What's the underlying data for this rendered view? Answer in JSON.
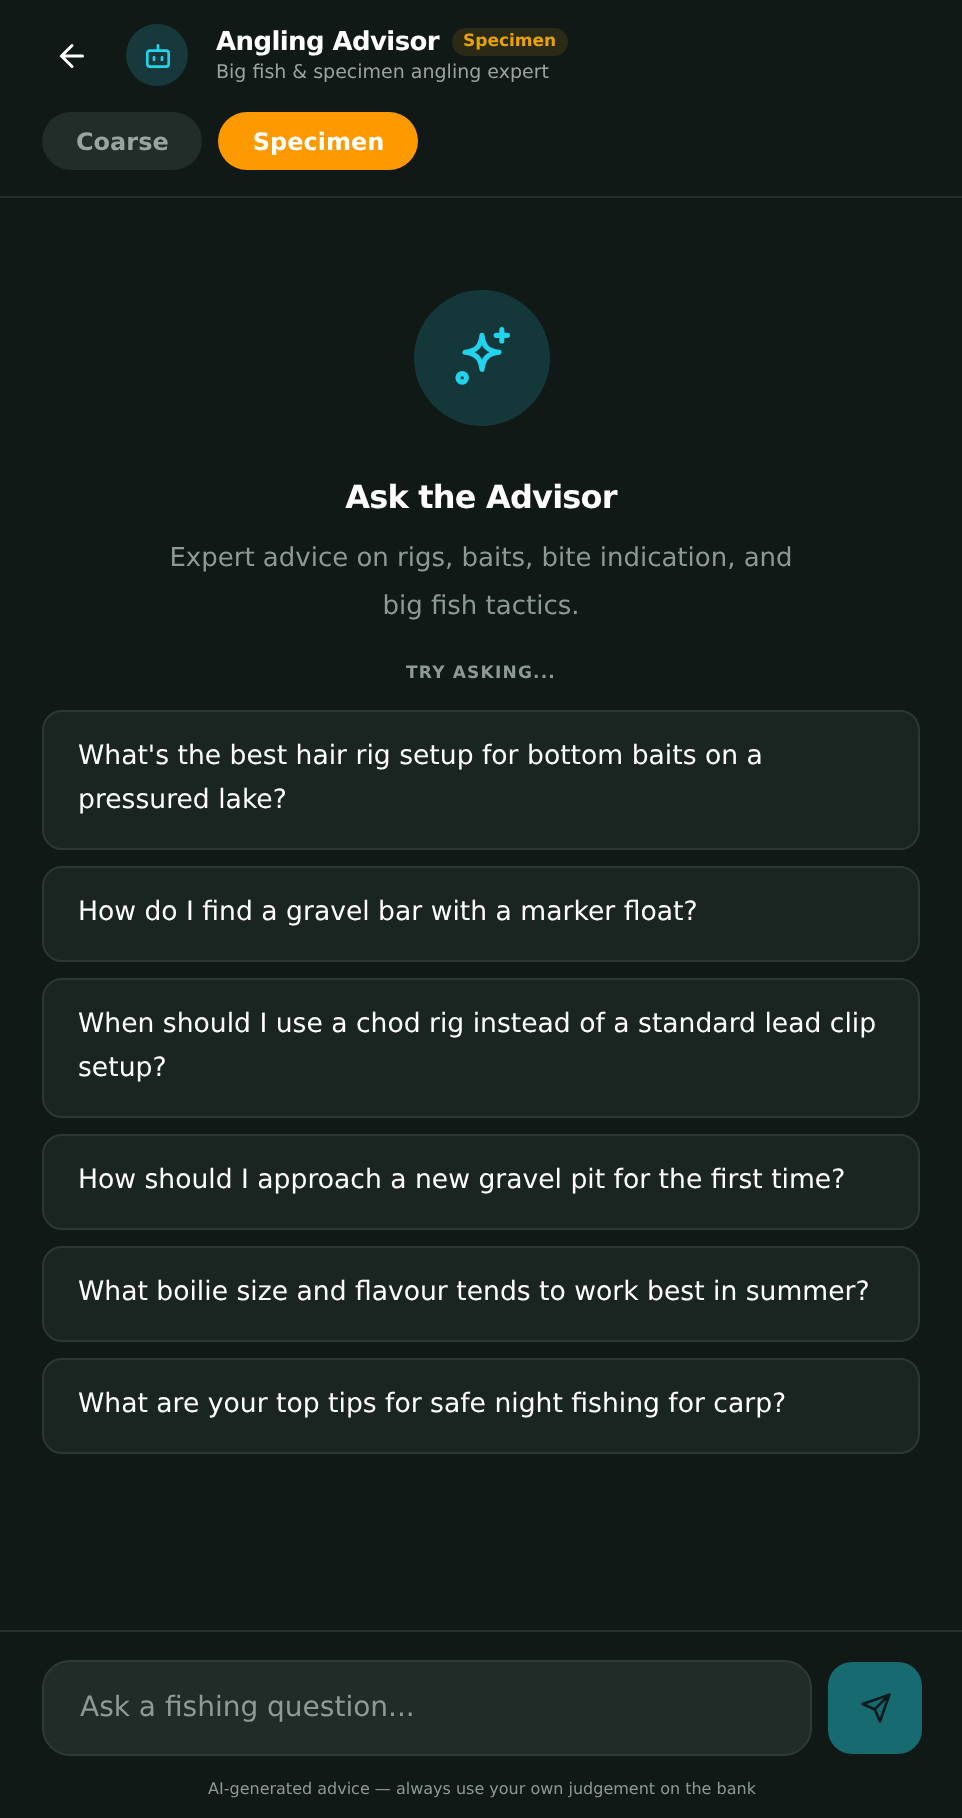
{
  "header": {
    "title": "Angling Advisor",
    "badge": "Specimen",
    "subtitle": "Big fish & specimen angling expert"
  },
  "modes": [
    {
      "label": "Coarse",
      "selected": false
    },
    {
      "label": "Specimen",
      "selected": true
    }
  ],
  "intro": {
    "title": "Ask the Advisor",
    "text": "Expert advice on rigs, baits, bite indication, and big fish tactics.",
    "prompt_heading": "TRY ASKING..."
  },
  "suggestions": [
    "What's the best hair rig setup for bottom baits on a pressured lake?",
    "How do I find a gravel bar with a marker float?",
    "When should I use a chod rig instead of a standard lead clip setup?",
    "How should I approach a new gravel pit for the first time?",
    "What boilie size and flavour tends to work best in summer?",
    "What are your top tips for safe night fishing for carp?"
  ],
  "composer": {
    "placeholder": "Ask a fishing question...",
    "disclaimer": "AI-generated advice — always use your own judgement on the bank"
  }
}
